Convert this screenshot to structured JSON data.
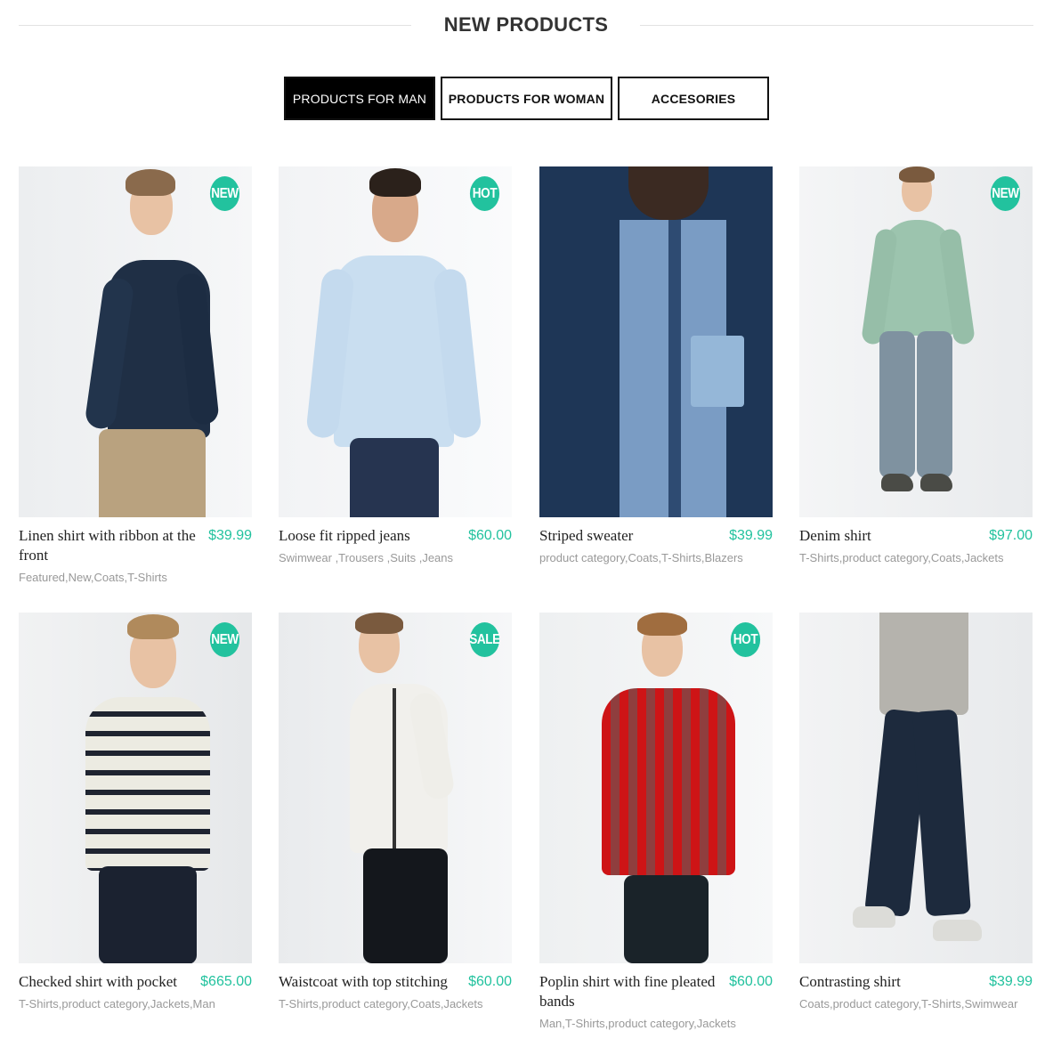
{
  "section": {
    "title": "NEW PRODUCTS"
  },
  "tabs": [
    {
      "label": "PRODUCTS FOR MAN",
      "active": true
    },
    {
      "label": "PRODUCTS FOR WOMAN",
      "active": false
    },
    {
      "label": "ACCESORIES",
      "active": false
    }
  ],
  "colors": {
    "accent": "#22c29e",
    "text": "#222222",
    "muted": "#999999",
    "tab_active_bg": "#000000"
  },
  "products": [
    {
      "title": "Linen shirt with ribbon at the front",
      "price": "$39.99",
      "categories": "Featured,New,Coats,T-Shirts",
      "badge": "NEW"
    },
    {
      "title": "Loose fit ripped jeans",
      "price": "$60.00",
      "categories": "Swimwear ,Trousers ,Suits ,Jeans",
      "badge": "HOT"
    },
    {
      "title": "Striped sweater",
      "price": "$39.99",
      "categories": "product category,Coats,T-Shirts,Blazers",
      "badge": ""
    },
    {
      "title": "Denim shirt",
      "price": "$97.00",
      "categories": "T-Shirts,product category,Coats,Jackets",
      "badge": "NEW"
    },
    {
      "title": "Checked shirt with pocket",
      "price": "$665.00",
      "categories": "T-Shirts,product category,Jackets,Man",
      "badge": "NEW"
    },
    {
      "title": "Waistcoat with top stitching",
      "price": "$60.00",
      "categories": "T-Shirts,product category,Coats,Jackets",
      "badge": "SALE"
    },
    {
      "title": "Poplin shirt with fine pleated bands",
      "price": "$60.00",
      "categories": "Man,T-Shirts,product category,Jackets",
      "badge": "HOT"
    },
    {
      "title": "Contrasting shirt",
      "price": "$39.99",
      "categories": "Coats,product category,T-Shirts,Swimwear",
      "badge": ""
    }
  ]
}
